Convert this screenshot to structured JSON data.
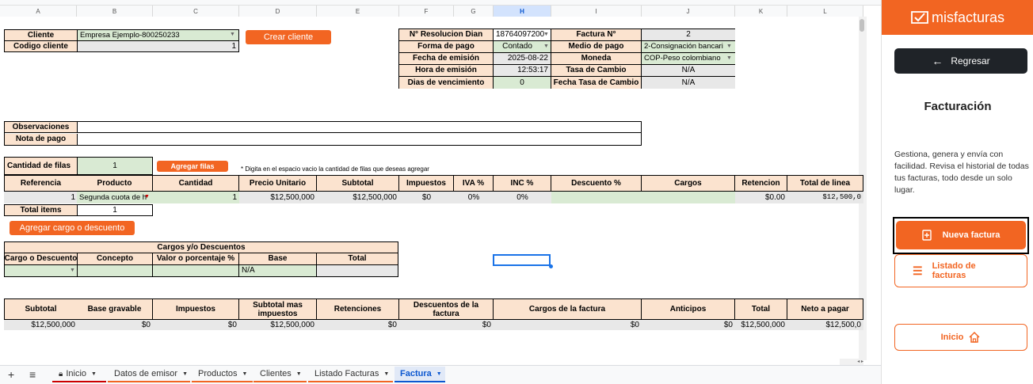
{
  "columns": [
    "A",
    "B",
    "C",
    "D",
    "E",
    "F",
    "G",
    "H",
    "I",
    "J",
    "K",
    "L"
  ],
  "client_block": {
    "cliente_label": "Cliente",
    "cliente_value": "Empresa Ejemplo-800250233",
    "codigo_label": "Codigo cliente",
    "codigo_value": "1",
    "crear_cliente_button": "Crear cliente"
  },
  "invoice_block": {
    "resolucion_label": "N° Resolucion Dian",
    "resolucion_value": "18764097200",
    "factura_label": "Factura N°",
    "factura_value": "2",
    "forma_pago_label": "Forma de pago",
    "forma_pago_value": "Contado",
    "medio_pago_label": "Medio de pago",
    "medio_pago_value": "2-Consignación bancari",
    "fecha_emision_label": "Fecha de emisión",
    "fecha_emision_value": "2025-08-22",
    "moneda_label": "Moneda",
    "moneda_value": "COP-Peso colombiano",
    "hora_emision_label": "Hora de emisión",
    "hora_emision_value": "12:53:17",
    "tasa_cambio_label": "Tasa de Cambio",
    "tasa_cambio_value": "N/A",
    "dias_venc_label": "Dias de vencimiento",
    "dias_venc_value": "0",
    "fecha_tasa_label": "Fecha Tasa de Cambio",
    "fecha_tasa_value": "N/A"
  },
  "notes": {
    "observaciones_label": "Observaciones",
    "nota_pago_label": "Nota de pago"
  },
  "rows_block": {
    "cantidad_filas_label": "Cantidad de filas",
    "cantidad_filas_value": "1",
    "agregar_filas_button": "Agregar filas",
    "hint": "* Digita en el espacio vacio la cantidad de filas que deseas agregar"
  },
  "items_table": {
    "headers": [
      "Referencia",
      "Producto",
      "Cantidad",
      "Precio Unitario",
      "Subtotal",
      "Impuestos",
      "IVA %",
      "INC %",
      "Descuento %",
      "Cargos",
      "Retencion",
      "Total de linea"
    ],
    "row": [
      "1",
      "Segunda cuota de h",
      "1",
      "$12,500,000",
      "$12,500,000",
      "$0",
      "0%",
      "0%",
      "",
      "",
      "$0.00",
      "$12,500,0"
    ],
    "total_items_label": "Total items",
    "total_items_value": "1"
  },
  "charges": {
    "button": "Agregar cargo o descuento",
    "title": "Cargos y/o Descuentos",
    "headers": [
      "Cargo o Descuento",
      "Concepto",
      "Valor o porcentaje %",
      "Base",
      "Total"
    ],
    "base_value": "N/A"
  },
  "totals": {
    "headers": [
      "Subtotal",
      "Base gravable",
      "Impuestos",
      "Subtotal mas impuestos",
      "Retenciones",
      "Descuentos de la factura",
      "Cargos de la factura",
      "Anticipos",
      "Total",
      "Neto a pagar"
    ],
    "values": [
      "$12,500,000",
      "$0",
      "$0",
      "$12,500,000",
      "$0",
      "$0",
      "$0",
      "$0",
      "$12,500,000",
      "$12,500,0"
    ]
  },
  "tabs": {
    "add": "+",
    "menu": "≡",
    "items": [
      "Inicio",
      "Datos de emisor",
      "Productos",
      "Clientes",
      "Listado Facturas",
      "Factura"
    ],
    "active": "Factura"
  },
  "panel": {
    "brand": "misfacturas",
    "regresar": "Regresar",
    "title": "Facturación",
    "description": "Gestiona, genera y envía con facilidad. Revisa el historial de todas tus facturas, todo desde un solo lugar.",
    "nueva_factura": "Nueva factura",
    "listado_facturas": "Listado de facturas",
    "inicio": "Inicio"
  },
  "colors": {
    "brand_orange": "#f26522",
    "header_orange": "#fbe3cf",
    "input_green": "#d9ead3",
    "readonly_grey": "#e8e8e8",
    "dark_button": "#1f2328"
  }
}
